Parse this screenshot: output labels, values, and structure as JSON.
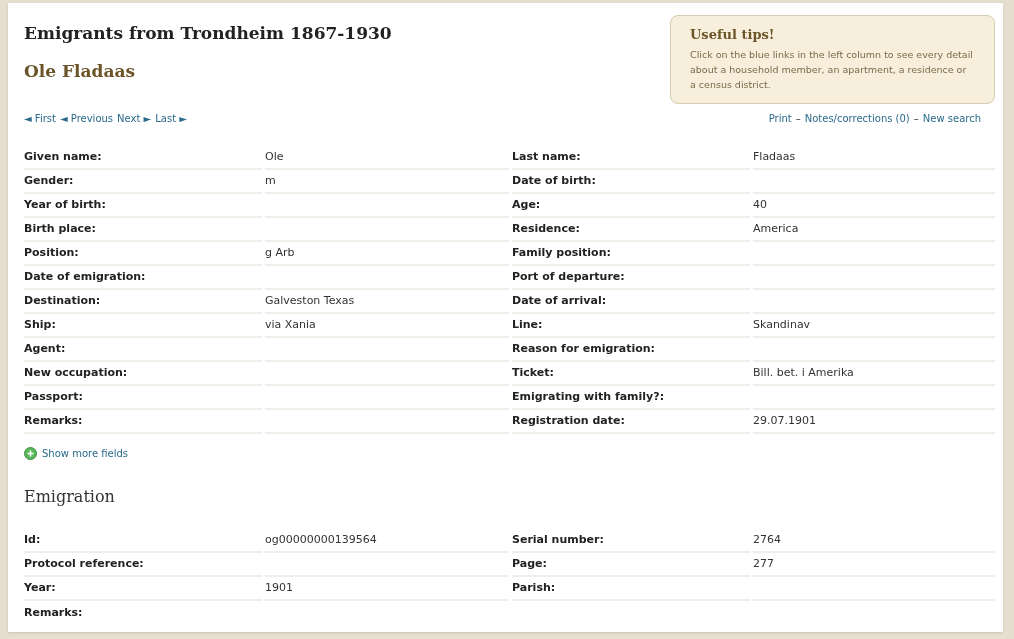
{
  "header": {
    "title": "Emigrants from Trondheim 1867-1930",
    "person": "Ole Fladaas"
  },
  "tips": {
    "title": "Useful tips!",
    "text": "Click on the blue links in the left column to see every detail about a household member, an apartment, a residence or a census district."
  },
  "pager": [
    {
      "label": "First",
      "arrow": "◄",
      "arrow_after": false
    },
    {
      "label": "Previous",
      "arrow": "◄",
      "arrow_after": false
    },
    {
      "label": "Next",
      "arrow": "►",
      "arrow_after": true
    },
    {
      "label": "Last",
      "arrow": "►",
      "arrow_after": true
    }
  ],
  "actions": {
    "separator": "–",
    "links": [
      "Print",
      "Notes/corrections (0)",
      "New search"
    ]
  },
  "fields": [
    {
      "label": "Given name:",
      "value": "Ole"
    },
    {
      "label": "Last name:",
      "value": "Fladaas"
    },
    {
      "label": "Gender:",
      "value": "m"
    },
    {
      "label": "Date of birth:"
    },
    {
      "label": "Year of birth:"
    },
    {
      "label": "Age:",
      "value": "40"
    },
    {
      "label": "Birth place:"
    },
    {
      "label": "Residence:",
      "value": "America"
    },
    {
      "label": "Position:",
      "value": "g Arb"
    },
    {
      "label": "Family position:"
    },
    {
      "label": "Date of emigration:"
    },
    {
      "label": "Port of departure:"
    },
    {
      "label": "Destination:",
      "value": "Galveston Texas"
    },
    {
      "label": "Date of arrival:"
    },
    {
      "label": "Ship:",
      "value": "via Xania"
    },
    {
      "label": "Line:",
      "value": "Skandinav"
    },
    {
      "label": "Agent:"
    },
    {
      "label": "Reason for emigration:"
    },
    {
      "label": "New occupation:"
    },
    {
      "label": "Ticket:",
      "value": "Bill. bet. i Amerika"
    },
    {
      "label": "Passport:"
    },
    {
      "label": "Emigrating with family?:"
    },
    {
      "label": "Remarks:"
    },
    {
      "label": "Registration date:",
      "value": "29.07.1901"
    }
  ],
  "show_more": "Show more fields",
  "emigration": {
    "title": "Emigration",
    "fields": [
      {
        "label": "Id:",
        "value": "og00000000139564"
      },
      {
        "label": "Serial number:",
        "value": "2764"
      },
      {
        "label": "Protocol reference:"
      },
      {
        "label": "Page:",
        "value": "277"
      },
      {
        "label": "Year:",
        "value": "1901"
      },
      {
        "label": "Parish:"
      },
      {
        "label": "Remarks:"
      }
    ]
  }
}
